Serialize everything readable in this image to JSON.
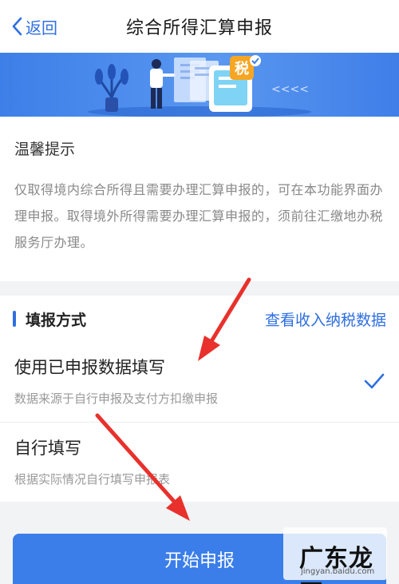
{
  "nav": {
    "back_label": "返回",
    "title": "综合所得汇算申报"
  },
  "banner": {
    "tax_badge": "税",
    "arrows": "<<<<"
  },
  "tips": {
    "title": "温馨提示",
    "body": "仅取得境内综合所得且需要办理汇算申报的，可在本功能界面办理申报。取得境外所得需要办理汇算申报的，须前往汇缴地办税服务厅办理。"
  },
  "fill_method": {
    "label": "填报方式",
    "link": "查看收入纳税数据",
    "options": [
      {
        "title": "使用已申报数据填写",
        "desc": "数据来源于自行申报及支付方扣缴申报",
        "selected": true
      },
      {
        "title": "自行填写",
        "desc": "根据实际情况自行填写申报表",
        "selected": false
      }
    ]
  },
  "submit": {
    "label": "开始申报"
  },
  "watermark": {
    "title": "广东龙网",
    "sub": "jingyan.baidu.com"
  },
  "colors": {
    "accent": "#2f6fe0",
    "button": "#3b7eea",
    "annotation_arrow": "#e8312c"
  }
}
